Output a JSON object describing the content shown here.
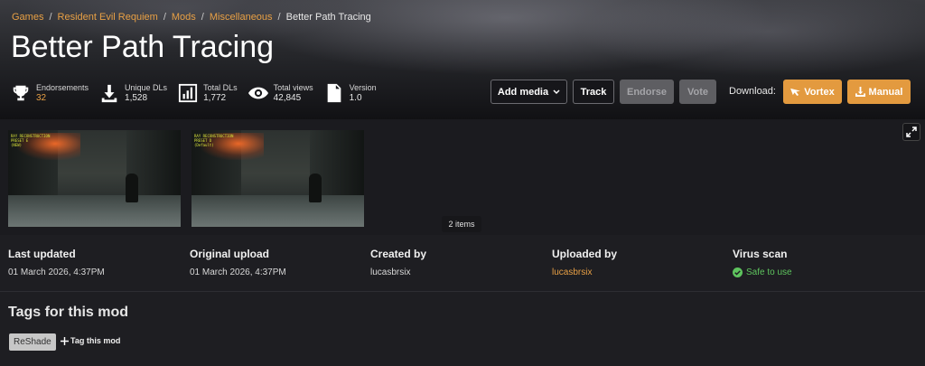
{
  "breadcrumb": {
    "items": [
      "Games",
      "Resident Evil Requiem",
      "Mods",
      "Miscellaneous"
    ],
    "current": "Better Path Tracing"
  },
  "mod": {
    "title": "Better Path Tracing"
  },
  "stats": {
    "endorsements": {
      "label": "Endorsements",
      "value": "32"
    },
    "unique_dls": {
      "label": "Unique DLs",
      "value": "1,528"
    },
    "total_dls": {
      "label": "Total DLs",
      "value": "1,772"
    },
    "total_views": {
      "label": "Total views",
      "value": "42,845"
    },
    "version": {
      "label": "Version",
      "value": "1.0"
    }
  },
  "actions": {
    "add_media": "Add media",
    "track": "Track",
    "endorse": "Endorse",
    "vote": "Vote",
    "download_label": "Download:",
    "vortex": "Vortex",
    "manual": "Manual"
  },
  "gallery": {
    "count_label": "2 items",
    "thumbs": [
      {
        "osd": [
          "RAY RECONSTRUCTION",
          "PRESET E",
          "(NEW)"
        ]
      },
      {
        "osd": [
          "RAY RECONSTRUCTION",
          "PRESET D",
          "(Default)"
        ]
      }
    ]
  },
  "meta": {
    "last_updated": {
      "label": "Last updated",
      "value": "01 March 2026, 4:37PM"
    },
    "original_upload": {
      "label": "Original upload",
      "value": "01 March 2026, 4:37PM"
    },
    "created_by": {
      "label": "Created by",
      "value": "lucasbrsix"
    },
    "uploaded_by": {
      "label": "Uploaded by",
      "value": "lucasbrsix"
    },
    "virus_scan": {
      "label": "Virus scan",
      "value": "Safe to use"
    }
  },
  "tags": {
    "title": "Tags for this mod",
    "items": [
      "ReShade"
    ],
    "add_label": "Tag this mod"
  },
  "colors": {
    "accent": "#e39a3f",
    "safe": "#5ec45e",
    "background": "#1e1e22"
  }
}
